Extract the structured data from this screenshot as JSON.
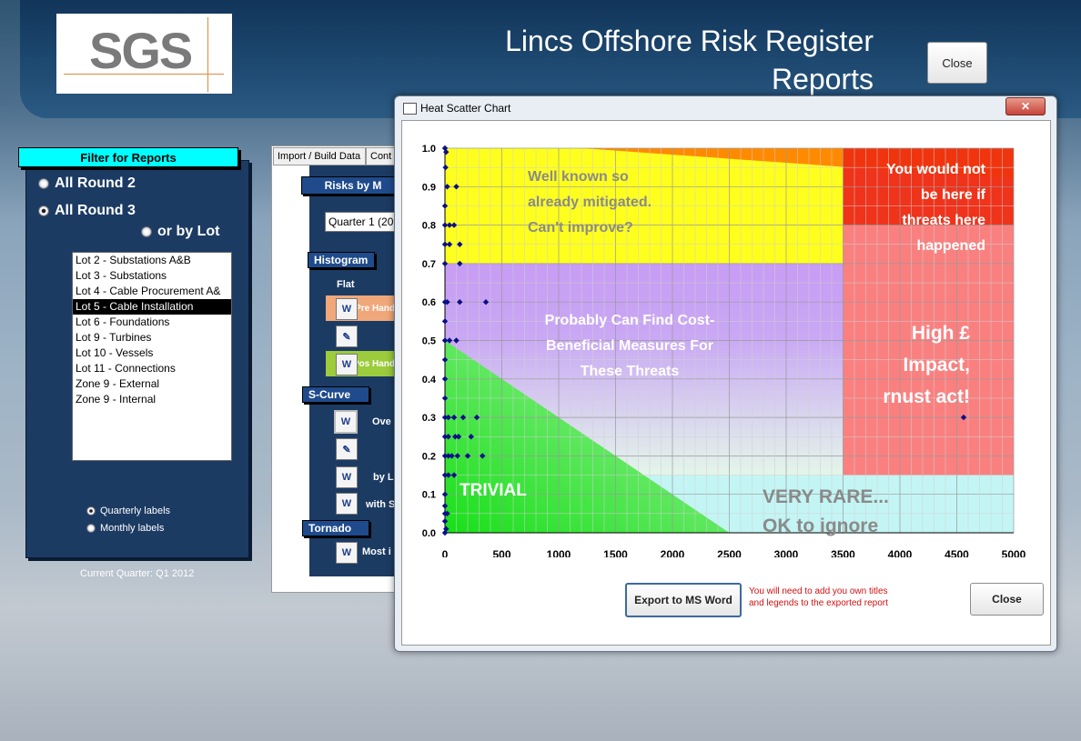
{
  "app": {
    "logo": "SGS",
    "title_line1": "Lincs Offshore Risk Register",
    "title_line2": "Reports",
    "close_label": "Close"
  },
  "filter": {
    "header": "Filter for Reports",
    "opt_all_round2": "All Round 2",
    "opt_all_round3": "All Round 3",
    "opt_by_lot": "or by Lot",
    "lots": [
      "Lot 2 - Substations A&B",
      "Lot 3 - Substations",
      "Lot 4 - Cable Procurement A&",
      "Lot 5 - Cable Installation",
      "Lot 6 - Foundations",
      "Lot 9 - Turbines",
      "Lot 10 - Vessels",
      "Lot 11 - Connections",
      "Zone 9 - External",
      "Zone 9 - Internal"
    ],
    "selected_lot": "Lot 5 - Cable Installation",
    "quarterly_labels": "Quarterly labels",
    "monthly_labels": "Monthly labels",
    "current_quarter": "Current Quarter: Q1 2012"
  },
  "reports": {
    "tab_import": "Import / Build Data",
    "tab_cont": "Cont",
    "risks_by": "Risks by M",
    "quarter_value": "Quarter 1 (20",
    "histogram": "Histogram",
    "flat": "Flat",
    "pre_label": "Pre Hand",
    "post_label": "Pos Hand",
    "s_curve": "S-Curve",
    "overall": "Ove",
    "by_lot": "by L",
    "with_s": "with S",
    "tornado": "Tornado",
    "most": "Most i"
  },
  "dialog": {
    "title": "Heat Scatter Chart",
    "export_label": "Export to MS Word",
    "note_line1": "You will need to add you own titles",
    "note_line2": "and legends to the exported report",
    "close_label": "Close"
  },
  "chart_data": {
    "type": "scatter",
    "xlim": [
      0,
      5000
    ],
    "ylim": [
      0,
      1.0
    ],
    "xticks": [
      0,
      500,
      1000,
      1500,
      2000,
      2500,
      3000,
      3500,
      4000,
      4500,
      5000
    ],
    "yticks": [
      0.0,
      0.1,
      0.2,
      0.3,
      0.4,
      0.5,
      0.6,
      0.7,
      0.8,
      0.9,
      1.0
    ],
    "grid": true,
    "annotations": {
      "well_known": [
        "Well known so",
        "already mitigated.",
        "Can't improve?"
      ],
      "would_not": [
        "You would not",
        "be here if",
        "threats here",
        "happened"
      ],
      "cost_beneficial": [
        "Probably Can Find Cost-",
        "Beneficial Measures For",
        "These Threats"
      ],
      "high_impact": [
        "High £",
        "Impact,",
        "rnust act!"
      ],
      "trivial": "TRIVIAL",
      "very_rare": [
        "VERY RARE...",
        "OK to ignore"
      ]
    },
    "points": [
      [
        0,
        1.0
      ],
      [
        10,
        0.99
      ],
      [
        5,
        0.95
      ],
      [
        20,
        0.9
      ],
      [
        100,
        0.9
      ],
      [
        0,
        0.85
      ],
      [
        0,
        0.8
      ],
      [
        40,
        0.8
      ],
      [
        80,
        0.8
      ],
      [
        0,
        0.75
      ],
      [
        40,
        0.75
      ],
      [
        130,
        0.75
      ],
      [
        0,
        0.7
      ],
      [
        130,
        0.7
      ],
      [
        0,
        0.6
      ],
      [
        20,
        0.6
      ],
      [
        130,
        0.6
      ],
      [
        360,
        0.6
      ],
      [
        0,
        0.55
      ],
      [
        0,
        0.5
      ],
      [
        40,
        0.5
      ],
      [
        100,
        0.5
      ],
      [
        0,
        0.45
      ],
      [
        0,
        0.4
      ],
      [
        0,
        0.35
      ],
      [
        0,
        0.3
      ],
      [
        30,
        0.3
      ],
      [
        80,
        0.3
      ],
      [
        160,
        0.3
      ],
      [
        280,
        0.3
      ],
      [
        0,
        0.25
      ],
      [
        30,
        0.25
      ],
      [
        90,
        0.25
      ],
      [
        120,
        0.25
      ],
      [
        230,
        0.25
      ],
      [
        0,
        0.2
      ],
      [
        30,
        0.2
      ],
      [
        60,
        0.2
      ],
      [
        110,
        0.2
      ],
      [
        200,
        0.2
      ],
      [
        330,
        0.2
      ],
      [
        0,
        0.15
      ],
      [
        30,
        0.15
      ],
      [
        80,
        0.15
      ],
      [
        0,
        0.1
      ],
      [
        0,
        0.07
      ],
      [
        0,
        0.05
      ],
      [
        20,
        0.05
      ],
      [
        0,
        0.03
      ],
      [
        0,
        0.0
      ],
      [
        10,
        0.01
      ],
      [
        4560,
        0.3
      ]
    ]
  }
}
